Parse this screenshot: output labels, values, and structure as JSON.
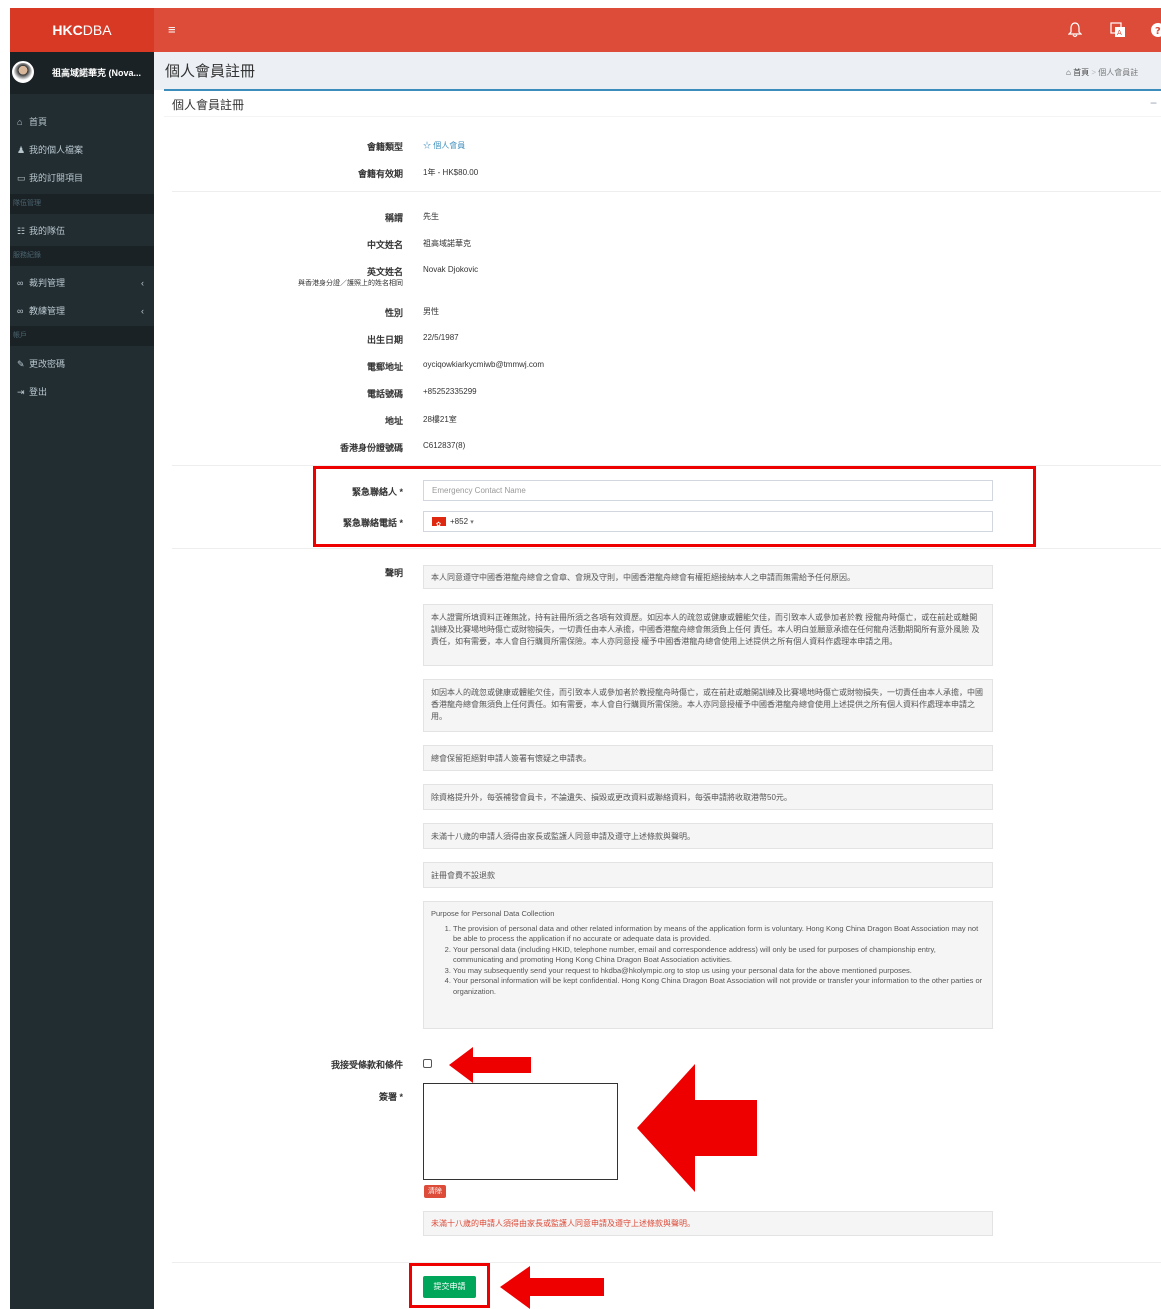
{
  "header": {
    "logo_bold": "HKC",
    "logo_rest": "DBA",
    "menu_icon": "hamburger-icon",
    "icons": [
      "bell-icon",
      "language-icon",
      "help-icon"
    ]
  },
  "user": {
    "name": "祖高域諾華克 (Nova..."
  },
  "sidebar": {
    "items": [
      {
        "icon": "home-icon",
        "label": "首頁"
      },
      {
        "icon": "user-icon",
        "label": "我的個人檔案"
      },
      {
        "icon": "card-icon",
        "label": "我的訂閱項目"
      }
    ],
    "section_team": "隊伍管理",
    "team_item": "我的隊伍",
    "section_service": "服務紀錄",
    "referee": "裁判管理",
    "coach": "教練管理",
    "section_account": "帳戶",
    "change_password": "更改密碼",
    "logout": "登出"
  },
  "page": {
    "title": "個人會員註冊",
    "breadcrumb_home": "首頁",
    "breadcrumb_sep": ">",
    "breadcrumb_current": "個人會員註",
    "box_title": "個人會員註冊",
    "collapse": "−"
  },
  "membership": {
    "type_label": "會籍類型",
    "type_value": "☆ 個人會員",
    "validity_label": "會籍有效期",
    "validity_value": "1年 - HK$80.00"
  },
  "profile": {
    "title_label": "稱謂",
    "title_value": "先生",
    "cname_label": "中文姓名",
    "cname_value": "祖高域諾華克",
    "ename_label": "英文姓名",
    "ename_note": "與香港身分證／護照上的姓名相同",
    "ename_value": "Novak Djokovic",
    "gender_label": "性別",
    "gender_value": "男性",
    "dob_label": "出生日期",
    "dob_value": "22/5/1987",
    "email_label": "電郵地址",
    "email_value": "oyciqowkiarkycmiwb@tmmwj.com",
    "phone_label": "電話號碼",
    "phone_value": "+85252335299",
    "address_label": "地址",
    "address_value": "28樓21室",
    "hkid_label": "香港身份證號碼",
    "hkid_value": "C612837(8)"
  },
  "emergency": {
    "name_label": "緊急聯絡人 *",
    "name_placeholder": "Emergency Contact Name",
    "phone_label": "緊急聯絡電話 *",
    "phone_code": "+852",
    "phone_caret": "▾"
  },
  "declaration": {
    "label": "聲明",
    "paragraphs": [
      "本人同意遵守中國香港龍舟總會之會章、會規及守則，中國香港龍舟總會有權拒絕接納本人之申請而無需給予任何原因。",
      "本人證實所填資料正確無訛，持有註冊所須之各項有效資歷。如因本人的疏忽或健康或體能欠佳，而引致本人或參加者於教 授龍舟時傷亡，或在前赴或離開訓練及比賽場地時傷亡或財物損失，一切責任由本人承擔，中國香港龍舟總會無須負上任何 責任。本人明白並願意承擔在任何龍舟活動期間所有意外風險 及責任，如有需要，本人會自行購買所需保險。本人亦同意授 權予中國香港龍舟總會使用上述提供之所有個人資料作處理本申請之用。",
      "如因本人的疏忽或健康或體能欠佳，而引致本人或參加者於教授龍舟時傷亡，或在前赴或離開訓練及比賽場地時傷亡或財物損失，一切責任由本人承擔，中國香港龍舟總會無須負上任何責任。如有需要，本人會自行購買所需保險。本人亦同意授權予中國香港龍舟總會使用上述提供之所有個人資料作處理本申請之用。",
      "總會保留拒絕對申請人簽署有懷疑之申請表。",
      "除資格提升外，每張補發會員卡，不論遺失、損毀或更改資料或聯絡資料，每張申請將收取港幣50元。",
      "未滿十八歲的申請人須得由家長或監護人同意申請及遵守上述條款與聲明。",
      "註冊會費不設退款"
    ],
    "privacy_title": "Purpose for Personal Data Collection",
    "privacy_items": [
      "The provision of personal data and other related information by means of the application form is voluntary. Hong Kong China Dragon Boat Association may not be able to process the application if no accurate or adequate data is provided.",
      "Your personal data (including HKID, telephone number, email and correspondence address) will only be used for purposes of championship entry, communicating and promoting Hong Kong China Dragon Boat Association activities.",
      "You may subsequently send your request to hkdba@hkolympic.org to stop us using your personal data for the above mentioned purposes.",
      "Your personal information will be kept confidential. Hong Kong China Dragon Boat Association will not provide or transfer your information to the other parties or organization."
    ]
  },
  "agreement": {
    "terms_label": "我接受條款和條件",
    "terms_checked": false,
    "signature_label": "簽署 *",
    "clear_label": "清除",
    "minor_notice": "未滿十八歲的申請人須得由家長或監護人同意申請及遵守上述條款與聲明。",
    "submit_label": "提交申請"
  },
  "colors": {
    "header": "#dd4b39",
    "sidebar": "#222d32",
    "accent": "#3c8dbc",
    "submit": "#00a65a",
    "annotation": "#ee0000"
  }
}
